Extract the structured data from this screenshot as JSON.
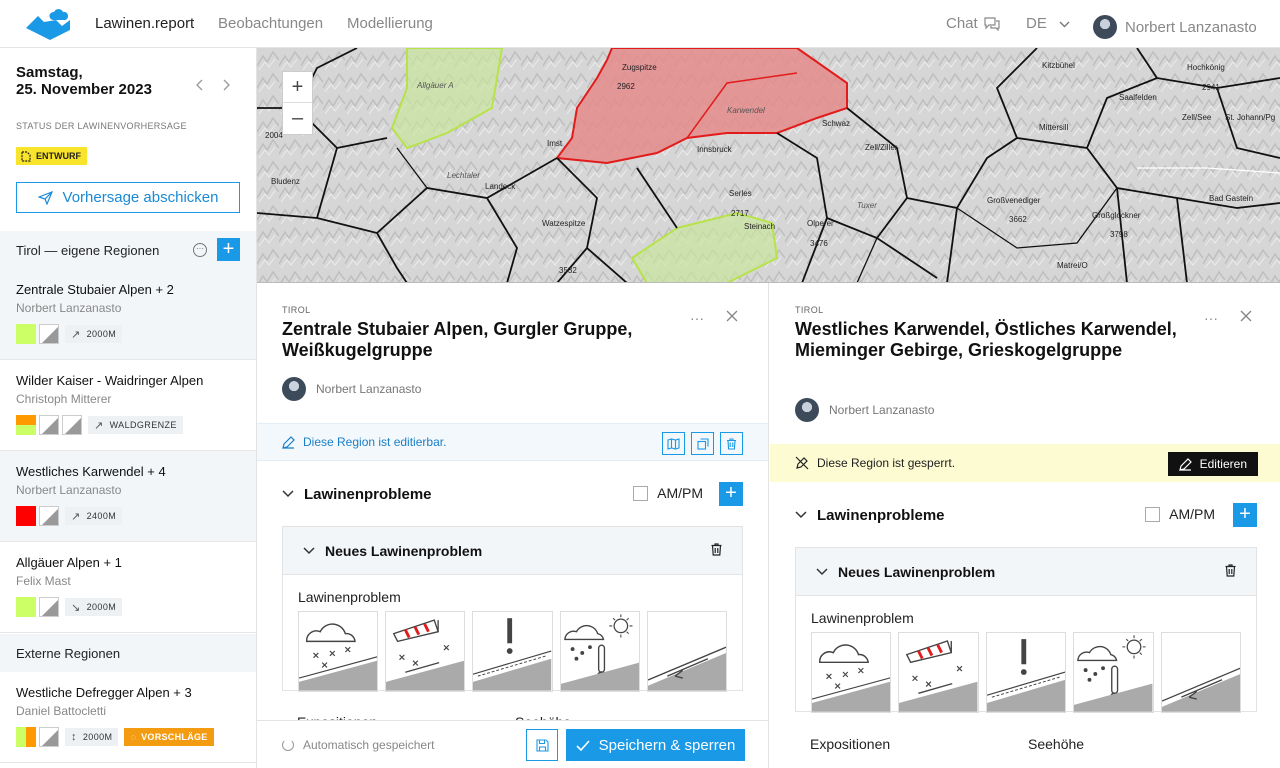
{
  "nav": {
    "brand": "Lawinen.report",
    "items": [
      "Beobachtungen",
      "Modellierung"
    ],
    "chat": "Chat",
    "language": "DE",
    "user": "Norbert Lanzanasto"
  },
  "sidebar": {
    "weekday": "Samstag,",
    "date": "25. November 2023",
    "status_label": "STATUS DER LAWINENVORHERSAGE",
    "status_badge": "ENTWURF",
    "submit_label": "Vorhersage abschicken",
    "own_regions_title": "Tirol — eigene Regionen",
    "external_title": "Externe Regionen",
    "regions": [
      {
        "name": "Zentrale Stubaier Alpen + 2",
        "author": "Norbert Lanzanasto",
        "elevation": "2000M",
        "danger_color": "#ccff66"
      },
      {
        "name": "Wilder Kaiser - Waidringer Alpen",
        "author": "Christoph Mitterer",
        "elevation": "WALDGRENZE",
        "danger_color": "#ff9900"
      },
      {
        "name": "Westliches Karwendel + 4",
        "author": "Norbert Lanzanasto",
        "elevation": "2400M",
        "danger_color": "#ff0000"
      },
      {
        "name": "Allgäuer Alpen + 1",
        "author": "Felix Mast",
        "elevation": "2000M",
        "danger_color": "#ccff66"
      }
    ],
    "external_regions": [
      {
        "name": "Westliche Defregger Alpen + 3",
        "author": "Daniel Battocletti",
        "elevation": "2000M",
        "proposals": "VORSCHLÄGE"
      }
    ]
  },
  "map": {
    "labels": [
      "Zugspitze",
      "2962",
      "Schwaz",
      "Kitzbühel",
      "Hochkönig",
      "2941",
      "Saalfelden",
      "Zell/See",
      "St. Johann/Pg",
      "Imst",
      "Innsbruck",
      "Mittersill",
      "Zell/Ziller",
      "Landeck",
      "Bludenz",
      "Serles",
      "2717",
      "Steinach",
      "Olperer",
      "3476",
      "Großvenediger",
      "3662",
      "Großglockner",
      "3798",
      "Bad Gastein",
      "Watzespitze",
      "3532",
      "Matrei/O",
      "2004",
      "Karwendel",
      "Lechtaler",
      "Tuxer",
      "Allgäuer A"
    ]
  },
  "panel_left": {
    "category": "TIROL",
    "title": "Zentrale Stubaier Alpen, Gurgler Gruppe, Weißkugelgruppe",
    "author": "Norbert Lanzanasto",
    "edit_status": "Diese Region ist editierbar.",
    "problems_title": "Lawinenprobleme",
    "ampm": "AM/PM",
    "new_problem": "Neues Lawinenproblem",
    "problem_label": "Lawinenproblem",
    "expositions_label": "Expositionen",
    "elevation_label": "Seehöhe",
    "autosave": "Automatisch gespeichert",
    "save_lock": "Speichern & sperren"
  },
  "panel_right": {
    "category": "TIROL",
    "title": "Westliches Karwendel, Östliches Karwendel, Mieminger Gebirge, Grieskogelgruppe",
    "author": "Norbert Lanzanasto",
    "lock_status": "Diese Region ist gesperrt.",
    "edit_button": "Editieren",
    "problems_title": "Lawinenprobleme",
    "ampm": "AM/PM",
    "new_problem": "Neues Lawinenproblem",
    "problem_label": "Lawinenproblem",
    "expositions_label": "Expositionen",
    "elevation_label": "Seehöhe"
  },
  "colors": {
    "accent": "#1a99e6",
    "draft": "#f8e42a",
    "proposal": "#f39c12",
    "locked_bg": "#fdfbd2",
    "danger_low": "#ccff66",
    "danger_considerable": "#ff9900",
    "danger_high": "#ff0000"
  }
}
